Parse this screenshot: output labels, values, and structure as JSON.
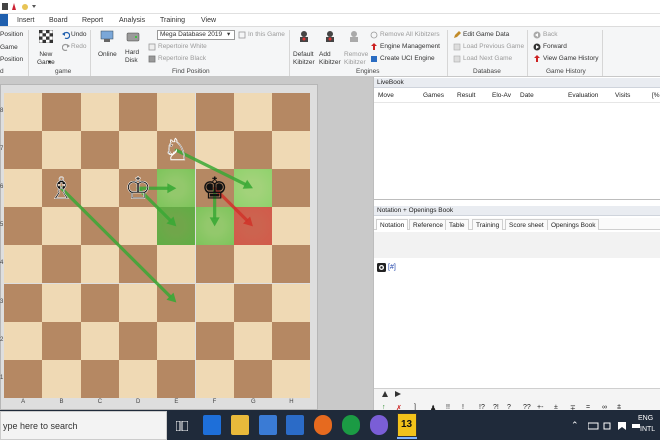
{
  "menu": {
    "tabs": [
      "Insert",
      "Board",
      "Report",
      "Analysis",
      "Training",
      "View"
    ]
  },
  "ribbon": {
    "clipboard": {
      "position_label_1": "Position",
      "game_label": "Game",
      "position_label_2": "Position",
      "group_label": "d"
    },
    "game": {
      "new_game": "New\nGame",
      "new_game_arrow": "▾",
      "undo": "Undo",
      "redo": "Redo",
      "group_label": "game"
    },
    "find_position": {
      "online": "Online",
      "hard_disk": "Hard\nDisk",
      "database_select": "Mega Database 2019",
      "in_this_game": "In this Game",
      "repertoire_white": "Repertoire White",
      "repertoire_black": "Repertoire Black",
      "group_label": "Find Position"
    },
    "engines": {
      "default_kibitzer": "Default\nKibitzer",
      "add_kibitzer": "Add\nKibitzer",
      "remove_kibitzer": "Remove\nKibitzer",
      "remove_all_kibitzers": "Remove All Kibitzers",
      "engine_management": "Engine Management",
      "create_uci_engine": "Create UCI Engine",
      "group_label": "Engines"
    },
    "database": {
      "edit_game_data": "Edit Game Data",
      "load_previous_game": "Load Previous Game",
      "load_next_game": "Load Next Game",
      "group_label": "Database"
    },
    "game_history": {
      "back": "Back",
      "forward": "Forward",
      "view_game_history": "View Game History",
      "group_label": "Game History"
    }
  },
  "board": {
    "ranks": [
      "8",
      "7",
      "6",
      "5",
      "4",
      "3",
      "2",
      "1"
    ],
    "files": [
      "A",
      "B",
      "C",
      "D",
      "E",
      "F",
      "G",
      "H"
    ],
    "pieces": [
      {
        "square": "e7",
        "glyph": "♘",
        "name": "white-knight"
      },
      {
        "square": "b6",
        "glyph": "♗",
        "name": "white-bishop"
      },
      {
        "square": "d6",
        "glyph": "♔",
        "name": "white-king"
      },
      {
        "square": "f6",
        "glyph": "♚",
        "name": "black-king"
      }
    ],
    "highlighted_squares": [
      {
        "square": "e6",
        "color": "#7cc45a"
      },
      {
        "square": "g6",
        "color": "#8fd16c"
      },
      {
        "square": "e5",
        "color": "#5fae44"
      },
      {
        "square": "f5",
        "color": "#7cc45a"
      },
      {
        "square": "g5",
        "color": "#d25a4a"
      }
    ],
    "arrows": [
      {
        "from": "e7",
        "to": "g6",
        "color": "#3aa835"
      },
      {
        "from": "d6",
        "to": "e6",
        "color": "#3aa835"
      },
      {
        "from": "d6",
        "to": "e5",
        "color": "#3aa835"
      },
      {
        "from": "f6",
        "to": "f5",
        "color": "#3aa835"
      },
      {
        "from": "f6",
        "to": "g5",
        "color": "#d0342a"
      },
      {
        "from": "b6",
        "to": "e3",
        "color": "#3aa835"
      }
    ]
  },
  "livebook": {
    "title": "LiveBook",
    "columns": [
      "Move",
      "Games",
      "Result",
      "Elo-Av",
      "Date",
      "Evaluation",
      "Visits",
      "[%"
    ]
  },
  "notation": {
    "title": "Notation + Openings Book",
    "tabs": [
      "Notation",
      "Reference",
      "Table",
      "Training",
      "Score sheet",
      "Openings Book"
    ],
    "content": "[#]"
  },
  "annotation_symbols": [
    "↑",
    "✗",
    "]",
    "♟",
    "!!",
    "!",
    "!?",
    "?!",
    "?",
    "??",
    "+-",
    "±",
    "∓",
    "=",
    "∞",
    "⩲"
  ],
  "taskbar": {
    "search_placeholder": "ype here to search",
    "app_badge": "13",
    "language": "ENG",
    "region": "INTL"
  },
  "colors": {
    "accent": "#1f5fae",
    "light_square": "#efd9b4",
    "dark_square": "#b58863"
  }
}
